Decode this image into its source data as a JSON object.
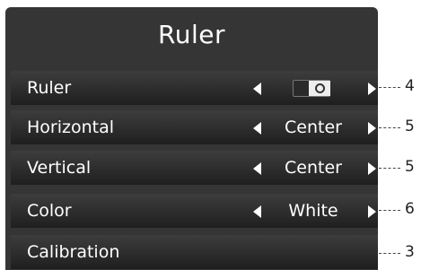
{
  "panel": {
    "title": "Ruler"
  },
  "rows": [
    {
      "label": "Ruler",
      "value": "",
      "control": "toggle",
      "callout": "4"
    },
    {
      "label": "Horizontal",
      "value": "Center",
      "control": "select",
      "callout": "5"
    },
    {
      "label": "Vertical",
      "value": "Center",
      "control": "select",
      "callout": "5"
    },
    {
      "label": "Color",
      "value": "White",
      "control": "select",
      "callout": "6"
    },
    {
      "label": "Calibration",
      "value": "",
      "control": "none",
      "callout": "3"
    }
  ],
  "colors": {
    "panel_bg": "#353535",
    "text": "#ffffff",
    "callout_text": "#222222"
  },
  "icons": {
    "left": "triangle-left-icon",
    "right": "triangle-right-icon"
  }
}
